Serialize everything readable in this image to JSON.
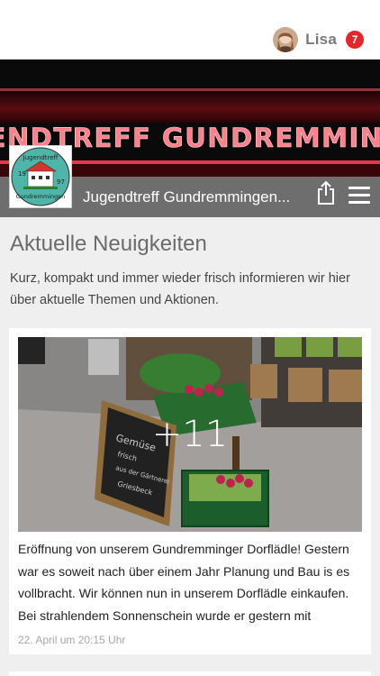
{
  "header": {
    "user_name": "Lisa",
    "notification_count": "7"
  },
  "hero": {
    "sign_text": "JUGENDTREFF GUNDREMMINGEN",
    "logo_text_top": "Jugendtreff",
    "logo_year_left": "19",
    "logo_year_right": "97",
    "logo_text_bottom": "Gundremmingen",
    "club_name": "Jugendtreff Gundremmingen..."
  },
  "news": {
    "title": "Aktuelle Neuigkeiten",
    "intro": "Kurz, kompakt und immer wieder frisch informieren wir hier über aktuelle Themen und Aktionen."
  },
  "post": {
    "photo_more": "+11",
    "text": "Eröffnung von unserem Gundremminger Dorflädle! Gestern war es soweit nach über einem Jahr Planung und Bau is es vollbracht. Wir können nun in unserem Dorflädle einkaufen. Bei strahlendem Sonnenschein wurde er gestern mit",
    "date": "22. April um 20:15 Uhr",
    "sign_words": [
      "Gemüse",
      "frisch",
      "aus der Gärtnerei",
      "Griesbeck"
    ]
  },
  "colors": {
    "badge": "#e2262a",
    "bar": "#6e6e6e",
    "sign_red": "#ff3b4e"
  }
}
